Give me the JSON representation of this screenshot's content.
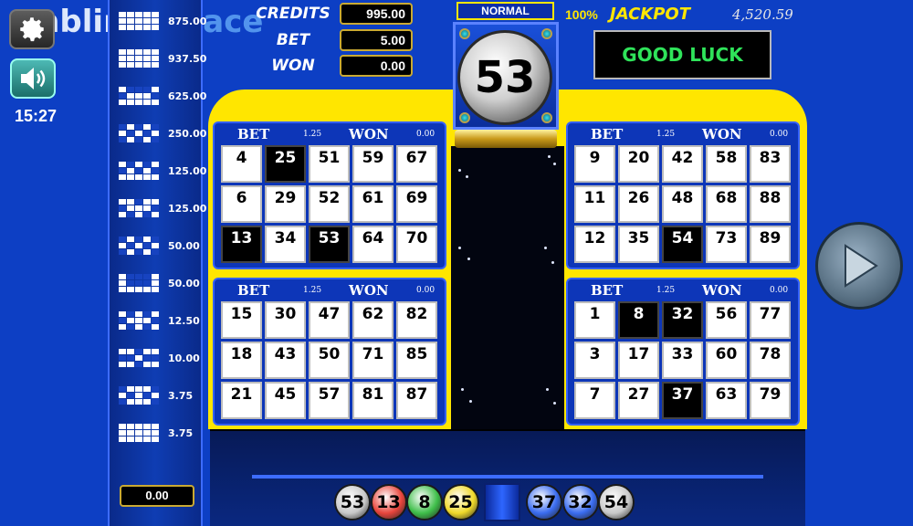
{
  "branding": {
    "logo_main": "mbling",
    "logo_accent": "Space"
  },
  "status": {
    "clock": "15:27"
  },
  "meters": {
    "credits_label": "CREDITS",
    "credits_value": "995.00",
    "bet_label": "BET",
    "bet_value": "5.00",
    "won_label": "WON",
    "won_value": "0.00"
  },
  "jackpot": {
    "percent": "100%",
    "label": "JACKPOT",
    "value": "4,520.59"
  },
  "message": "GOOD LUCK",
  "mode": "NORMAL",
  "current_ball": "53",
  "paytable": {
    "rows": [
      {
        "value": "875.00",
        "pattern": "11111/11111/11111"
      },
      {
        "value": "937.50",
        "pattern": "11111/11111/11111"
      },
      {
        "value": "625.00",
        "pattern": "10001/01110/11111"
      },
      {
        "value": "250.00",
        "pattern": "01010/10101/01010"
      },
      {
        "value": "125.00",
        "pattern": "10101/01010/11111"
      },
      {
        "value": "125.00",
        "pattern": "11011/01110/10101"
      },
      {
        "value": "50.00",
        "pattern": "01010/10101/01010"
      },
      {
        "value": "50.00",
        "pattern": "10001/10001/11111"
      },
      {
        "value": "12.50",
        "pattern": "10101/01110/10101"
      },
      {
        "value": "10.00",
        "pattern": "11011/00100/11011"
      },
      {
        "value": "3.75",
        "pattern": "01110/10101/01110"
      },
      {
        "value": "3.75",
        "pattern": "11111/11111/11111"
      }
    ],
    "total": "0.00"
  },
  "cards": [
    {
      "bet_label": "BET",
      "bet_value": "1.25",
      "won_label": "WON",
      "won_value": "0.00",
      "numbers": [
        "4",
        "25",
        "51",
        "59",
        "67",
        "6",
        "29",
        "52",
        "61",
        "69",
        "13",
        "34",
        "53",
        "64",
        "70"
      ],
      "hits": [
        1,
        10,
        12
      ]
    },
    {
      "bet_label": "BET",
      "bet_value": "1.25",
      "won_label": "WON",
      "won_value": "0.00",
      "numbers": [
        "9",
        "20",
        "42",
        "58",
        "83",
        "11",
        "26",
        "48",
        "68",
        "88",
        "12",
        "35",
        "54",
        "73",
        "89"
      ],
      "hits": [
        12
      ]
    },
    {
      "bet_label": "BET",
      "bet_value": "1.25",
      "won_label": "WON",
      "won_value": "0.00",
      "numbers": [
        "15",
        "30",
        "47",
        "62",
        "82",
        "18",
        "43",
        "50",
        "71",
        "85",
        "21",
        "45",
        "57",
        "81",
        "87"
      ],
      "hits": []
    },
    {
      "bet_label": "BET",
      "bet_value": "1.25",
      "won_label": "WON",
      "won_value": "0.00",
      "numbers": [
        "1",
        "8",
        "32",
        "56",
        "77",
        "3",
        "17",
        "33",
        "60",
        "78",
        "7",
        "27",
        "37",
        "63",
        "79"
      ],
      "hits": [
        1,
        2,
        12
      ]
    }
  ],
  "drawn_balls": [
    {
      "number": "53",
      "color": "#c9c9c9"
    },
    {
      "number": "13",
      "color": "#e8453c"
    },
    {
      "number": "8",
      "color": "#3fbf4a"
    },
    {
      "number": "25",
      "color": "#f0d92a"
    },
    {
      "number": "37",
      "color": "#3a6cf0"
    },
    {
      "number": "32",
      "color": "#3a6cf0"
    },
    {
      "number": "54",
      "color": "#c9c9c9"
    }
  ],
  "icons": {
    "settings": "gear-icon",
    "sound": "speaker-icon",
    "play": "play-icon"
  }
}
